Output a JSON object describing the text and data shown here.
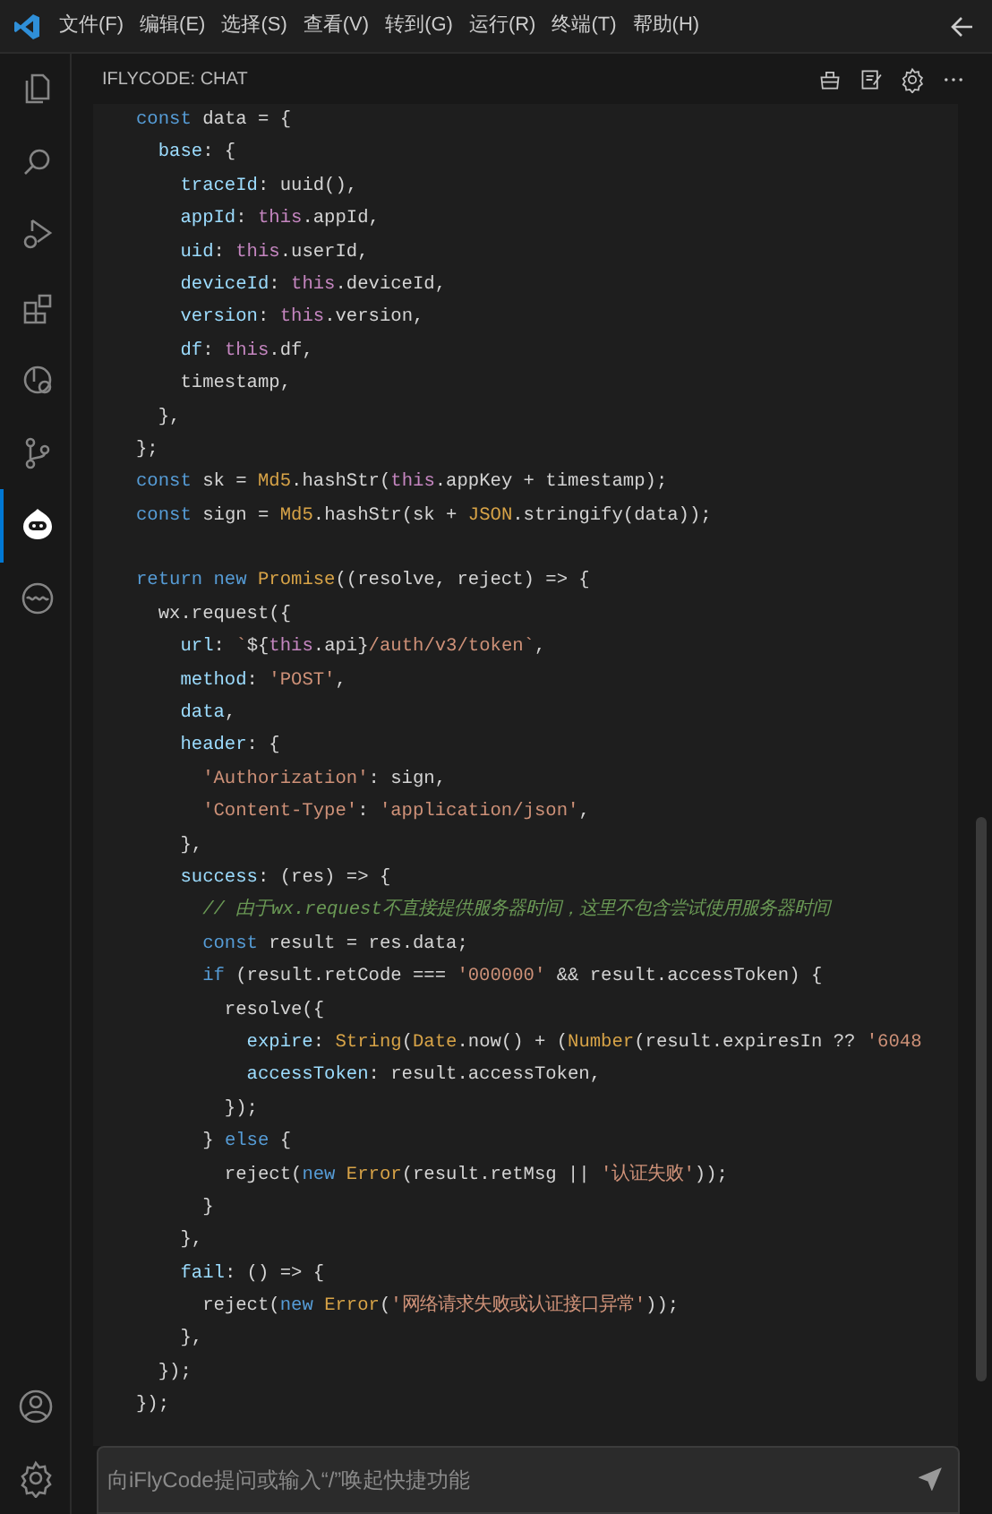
{
  "menu": [
    "文件(F)",
    "编辑(E)",
    "选择(S)",
    "查看(V)",
    "转到(G)",
    "运行(R)",
    "终端(T)",
    "帮助(H)"
  ],
  "activity_bar": [
    {
      "kind": "files",
      "selected": false
    },
    {
      "kind": "search",
      "selected": false
    },
    {
      "kind": "debug",
      "selected": false
    },
    {
      "kind": "extensions",
      "selected": false
    },
    {
      "kind": "remote",
      "selected": false
    },
    {
      "kind": "source-control",
      "selected": false
    },
    {
      "kind": "robot",
      "selected": true
    },
    {
      "kind": "wave",
      "selected": false
    }
  ],
  "activity_bottom": [
    {
      "kind": "account"
    },
    {
      "kind": "settings"
    }
  ],
  "panel": {
    "title": "IFLYCODE: CHAT",
    "actions": [
      {
        "kind": "broom"
      },
      {
        "kind": "note"
      },
      {
        "kind": "settings"
      },
      {
        "kind": "more"
      }
    ]
  },
  "code": [
    {
      "kind": "code",
      "tokens": [
        {
          "kind": "kw",
          "text": "const"
        },
        {
          "kind": "pl",
          "text": " data = {"
        }
      ]
    },
    {
      "kind": "code",
      "tokens": [
        {
          "kind": "prop",
          "text": "  base"
        },
        {
          "kind": "pl",
          "text": ": {"
        }
      ]
    },
    {
      "kind": "code",
      "tokens": [
        {
          "kind": "prop",
          "text": "    traceId"
        },
        {
          "kind": "pl",
          "text": ": uuid(),"
        }
      ]
    },
    {
      "kind": "code",
      "tokens": [
        {
          "kind": "prop",
          "text": "    appId"
        },
        {
          "kind": "pl",
          "text": ": "
        },
        {
          "kind": "th",
          "text": "this"
        },
        {
          "kind": "pl",
          "text": ".appId,"
        }
      ]
    },
    {
      "kind": "code",
      "tokens": [
        {
          "kind": "prop",
          "text": "    uid"
        },
        {
          "kind": "pl",
          "text": ": "
        },
        {
          "kind": "th",
          "text": "this"
        },
        {
          "kind": "pl",
          "text": ".userId,"
        }
      ]
    },
    {
      "kind": "code",
      "tokens": [
        {
          "kind": "prop",
          "text": "    deviceId"
        },
        {
          "kind": "pl",
          "text": ": "
        },
        {
          "kind": "th",
          "text": "this"
        },
        {
          "kind": "pl",
          "text": ".deviceId,"
        }
      ]
    },
    {
      "kind": "code",
      "tokens": [
        {
          "kind": "prop",
          "text": "    version"
        },
        {
          "kind": "pl",
          "text": ": "
        },
        {
          "kind": "th",
          "text": "this"
        },
        {
          "kind": "pl",
          "text": ".version,"
        }
      ]
    },
    {
      "kind": "code",
      "tokens": [
        {
          "kind": "prop",
          "text": "    df"
        },
        {
          "kind": "pl",
          "text": ": "
        },
        {
          "kind": "th",
          "text": "this"
        },
        {
          "kind": "pl",
          "text": ".df,"
        }
      ]
    },
    {
      "kind": "code",
      "tokens": [
        {
          "kind": "pl",
          "text": "    timestamp,"
        }
      ]
    },
    {
      "kind": "code",
      "tokens": [
        {
          "kind": "pl",
          "text": "  },"
        }
      ]
    },
    {
      "kind": "code",
      "tokens": [
        {
          "kind": "pl",
          "text": "};"
        }
      ]
    },
    {
      "kind": "code",
      "tokens": [
        {
          "kind": "kw",
          "text": "const"
        },
        {
          "kind": "pl",
          "text": " sk = "
        },
        {
          "kind": "ty",
          "text": "Md5"
        },
        {
          "kind": "pl",
          "text": ".hashStr("
        },
        {
          "kind": "th",
          "text": "this"
        },
        {
          "kind": "pl",
          "text": ".appKey + timestamp);"
        }
      ]
    },
    {
      "kind": "code",
      "tokens": [
        {
          "kind": "kw",
          "text": "const"
        },
        {
          "kind": "pl",
          "text": " sign = "
        },
        {
          "kind": "ty",
          "text": "Md5"
        },
        {
          "kind": "pl",
          "text": ".hashStr(sk + "
        },
        {
          "kind": "ty",
          "text": "JSON"
        },
        {
          "kind": "pl",
          "text": ".stringify(data));"
        }
      ]
    },
    {
      "kind": "blank"
    },
    {
      "kind": "code",
      "tokens": [
        {
          "kind": "kw",
          "text": "return new"
        },
        {
          "kind": "ty",
          "text": " Promise"
        },
        {
          "kind": "pl",
          "text": "((resolve, reject) => {"
        }
      ]
    },
    {
      "kind": "code",
      "tokens": [
        {
          "kind": "pl",
          "text": "  wx.request({"
        }
      ]
    },
    {
      "kind": "code",
      "tokens": [
        {
          "kind": "prop",
          "text": "    url"
        },
        {
          "kind": "pl",
          "text": ": "
        },
        {
          "kind": "str",
          "text": "`"
        },
        {
          "kind": "pl",
          "text": "${"
        },
        {
          "kind": "th",
          "text": "this"
        },
        {
          "kind": "pl",
          "text": ".api}"
        },
        {
          "kind": "str",
          "text": "/auth/v3/token`"
        },
        {
          "kind": "pl",
          "text": ","
        }
      ]
    },
    {
      "kind": "code",
      "tokens": [
        {
          "kind": "prop",
          "text": "    method"
        },
        {
          "kind": "pl",
          "text": ": "
        },
        {
          "kind": "str",
          "text": "'POST'"
        },
        {
          "kind": "pl",
          "text": ","
        }
      ]
    },
    {
      "kind": "code",
      "tokens": [
        {
          "kind": "prop",
          "text": "    data"
        },
        {
          "kind": "pl",
          "text": ","
        }
      ]
    },
    {
      "kind": "code",
      "tokens": [
        {
          "kind": "prop",
          "text": "    header"
        },
        {
          "kind": "pl",
          "text": ": {"
        }
      ]
    },
    {
      "kind": "code",
      "tokens": [
        {
          "kind": "str",
          "text": "      'Authorization'"
        },
        {
          "kind": "pl",
          "text": ": sign,"
        }
      ]
    },
    {
      "kind": "code",
      "tokens": [
        {
          "kind": "str",
          "text": "      'Content-Type'"
        },
        {
          "kind": "pl",
          "text": ": "
        },
        {
          "kind": "str",
          "text": "'application/json'"
        },
        {
          "kind": "pl",
          "text": ","
        }
      ]
    },
    {
      "kind": "code",
      "tokens": [
        {
          "kind": "pl",
          "text": "    },"
        }
      ]
    },
    {
      "kind": "code",
      "tokens": [
        {
          "kind": "prop",
          "text": "    success"
        },
        {
          "kind": "pl",
          "text": ": (res) => {"
        }
      ]
    },
    {
      "kind": "code",
      "tokens": [
        {
          "kind": "cm",
          "text": "      // 由于wx.request不直接提供服务器时间，这里不包含尝试使用服务器时间"
        }
      ]
    },
    {
      "kind": "code",
      "tokens": [
        {
          "kind": "kw",
          "text": "      const"
        },
        {
          "kind": "pl",
          "text": " result = res.data;"
        }
      ]
    },
    {
      "kind": "code",
      "tokens": [
        {
          "kind": "kw",
          "text": "      if"
        },
        {
          "kind": "pl",
          "text": " (result.retCode === "
        },
        {
          "kind": "str",
          "text": "'000000'"
        },
        {
          "kind": "pl",
          "text": " && result.accessToken) {"
        }
      ]
    },
    {
      "kind": "code",
      "tokens": [
        {
          "kind": "pl",
          "text": "        resolve({"
        }
      ]
    },
    {
      "kind": "code",
      "tokens": [
        {
          "kind": "prop",
          "text": "          expire"
        },
        {
          "kind": "pl",
          "text": ": "
        },
        {
          "kind": "ty",
          "text": "String"
        },
        {
          "kind": "pl",
          "text": "("
        },
        {
          "kind": "ty",
          "text": "Date"
        },
        {
          "kind": "pl",
          "text": ".now() + ("
        },
        {
          "kind": "ty",
          "text": "Number"
        },
        {
          "kind": "pl",
          "text": "(result.expiresIn ?? "
        },
        {
          "kind": "str",
          "text": "'6048"
        }
      ]
    },
    {
      "kind": "code",
      "tokens": [
        {
          "kind": "prop",
          "text": "          accessToken"
        },
        {
          "kind": "pl",
          "text": ": result.accessToken,"
        }
      ]
    },
    {
      "kind": "code",
      "tokens": [
        {
          "kind": "pl",
          "text": "        });"
        }
      ]
    },
    {
      "kind": "code",
      "tokens": [
        {
          "kind": "pl",
          "text": "      } "
        },
        {
          "kind": "kw",
          "text": "else"
        },
        {
          "kind": "pl",
          "text": " {"
        }
      ]
    },
    {
      "kind": "code",
      "tokens": [
        {
          "kind": "pl",
          "text": "        reject("
        },
        {
          "kind": "kw",
          "text": "new"
        },
        {
          "kind": "ty",
          "text": " Error"
        },
        {
          "kind": "pl",
          "text": "(result.retMsg || "
        },
        {
          "kind": "str",
          "text": "'认证失败'"
        },
        {
          "kind": "pl",
          "text": "));"
        }
      ]
    },
    {
      "kind": "code",
      "tokens": [
        {
          "kind": "pl",
          "text": "      }"
        }
      ]
    },
    {
      "kind": "code",
      "tokens": [
        {
          "kind": "pl",
          "text": "    },"
        }
      ]
    },
    {
      "kind": "code",
      "tokens": [
        {
          "kind": "prop",
          "text": "    fail"
        },
        {
          "kind": "pl",
          "text": ": () => {"
        }
      ]
    },
    {
      "kind": "code",
      "tokens": [
        {
          "kind": "pl",
          "text": "      reject("
        },
        {
          "kind": "kw",
          "text": "new"
        },
        {
          "kind": "ty",
          "text": " Error"
        },
        {
          "kind": "pl",
          "text": "("
        },
        {
          "kind": "str",
          "text": "'网络请求失败或认证接口异常'"
        },
        {
          "kind": "pl",
          "text": "));"
        }
      ]
    },
    {
      "kind": "code",
      "tokens": [
        {
          "kind": "pl",
          "text": "    },"
        }
      ]
    },
    {
      "kind": "code",
      "tokens": [
        {
          "kind": "pl",
          "text": "  });"
        }
      ]
    },
    {
      "kind": "code",
      "tokens": [
        {
          "kind": "pl",
          "text": "});"
        }
      ]
    }
  ],
  "input": {
    "placeholder": "向iFlyCode提问或输入“/”唤起快捷功能"
  }
}
